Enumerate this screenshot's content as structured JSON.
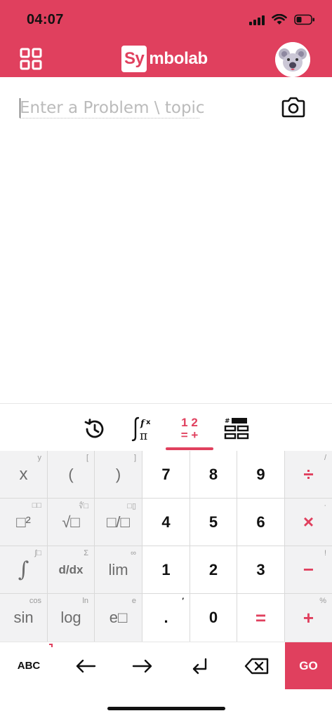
{
  "theme": {
    "brand": "#e0405e",
    "key_gray": "#f2f2f3",
    "key_white": "#ffffff"
  },
  "status_bar": {
    "time": "04:07",
    "icons": [
      "signal-icon",
      "wifi-icon",
      "battery-icon"
    ]
  },
  "header": {
    "menu_icon": "grid-icon",
    "logo_box": "Sy",
    "logo_rest": "mbolab",
    "avatar_icon": "koala-avatar-icon"
  },
  "input": {
    "placeholder": "Enter a Problem \\ topic",
    "value": "",
    "camera_icon": "camera-icon"
  },
  "keyboard_tabs": [
    {
      "name": "history",
      "icon": "history-icon",
      "active": false
    },
    {
      "name": "functions",
      "icon": "integral-functions-icon",
      "active": false
    },
    {
      "name": "numbers",
      "icon": "numbers-icon",
      "active": true,
      "top": "1 2",
      "bottom": "= +"
    },
    {
      "name": "matrix",
      "icon": "matrix-icon",
      "active": false
    }
  ],
  "keys": {
    "row1": [
      {
        "label": "x",
        "sup": "y"
      },
      {
        "label": "(",
        "sup": "["
      },
      {
        "label": ")",
        "sup": "]"
      },
      {
        "label": "7"
      },
      {
        "label": "8"
      },
      {
        "label": "9"
      },
      {
        "label": "÷",
        "sup": "/"
      }
    ],
    "row2": [
      {
        "label": "□²",
        "sup": "□□"
      },
      {
        "label": "√□",
        "sup": "∜□"
      },
      {
        "label": "□/□",
        "sup": "□▯"
      },
      {
        "label": "4"
      },
      {
        "label": "5"
      },
      {
        "label": "6"
      },
      {
        "label": "×",
        "sup": "·"
      }
    ],
    "row3": [
      {
        "label": "∫",
        "sup": "∫□"
      },
      {
        "label": "d/dx",
        "sup": "Σ"
      },
      {
        "label": "lim",
        "sup": "∞"
      },
      {
        "label": "1"
      },
      {
        "label": "2"
      },
      {
        "label": "3"
      },
      {
        "label": "−",
        "sup": "!"
      }
    ],
    "row4": [
      {
        "label": "sin",
        "sup": "cos"
      },
      {
        "label": "log",
        "sup": "ln"
      },
      {
        "label": "e□",
        "sup": "e"
      },
      {
        "label": ".",
        "sup": "′"
      },
      {
        "label": "0"
      },
      {
        "label": "="
      },
      {
        "label": "+",
        "sup": "%"
      }
    ]
  },
  "bottom_bar": {
    "abc": "ABC",
    "left_icon": "arrow-left-icon",
    "right_icon": "arrow-right-icon",
    "enter_icon": "enter-icon",
    "backspace_icon": "backspace-icon",
    "go": "GO"
  }
}
